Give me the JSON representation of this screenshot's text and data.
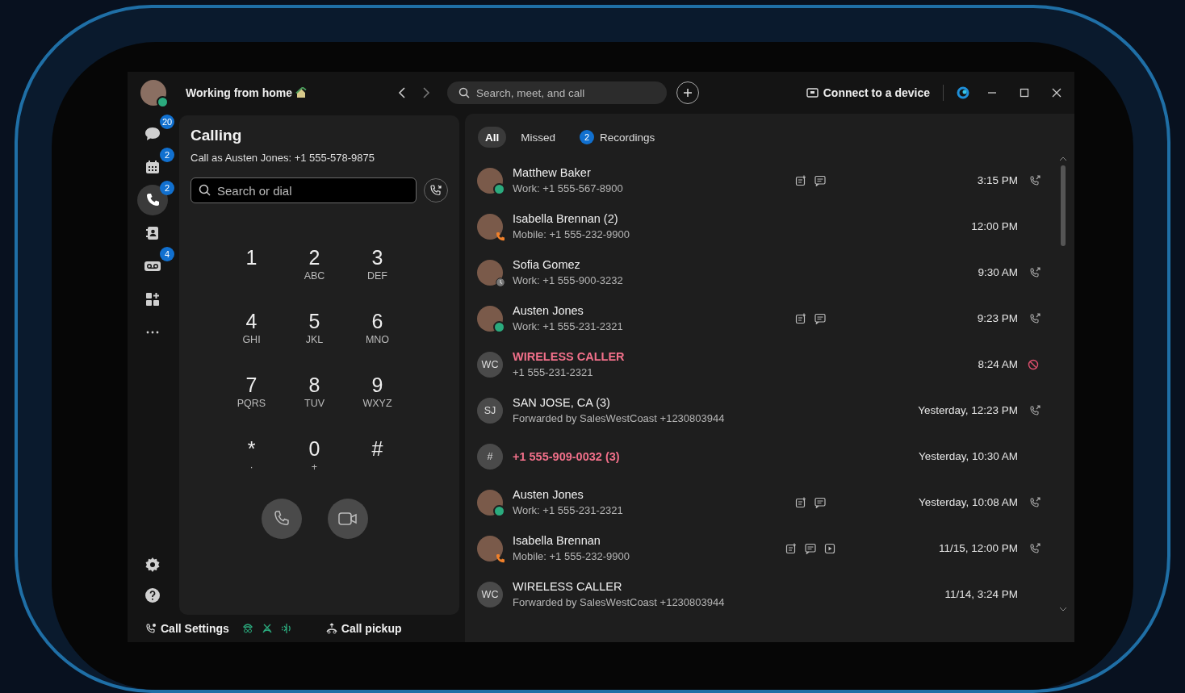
{
  "top_bar": {
    "status": "Working from home",
    "search": {
      "placeholder": "Search, meet, and call"
    },
    "connect_button": "Connect to a device"
  },
  "sidebar": {
    "items": [
      {
        "kind": "chat",
        "badge": "20",
        "selected": false
      },
      {
        "kind": "calendar",
        "badge": "2",
        "selected": false
      },
      {
        "kind": "phone",
        "badge": "2",
        "selected": true
      },
      {
        "kind": "contacts",
        "selected": false
      },
      {
        "kind": "voicemail",
        "badge": "4",
        "selected": false
      },
      {
        "kind": "apps",
        "selected": false
      },
      {
        "kind": "more",
        "selected": false
      }
    ]
  },
  "calling": {
    "title": "Calling",
    "subtitle": "Call as Austen Jones: +1 555-578-9875",
    "dial_field": {
      "placeholder": "Search or dial"
    },
    "keypad": [
      {
        "digit": "1"
      },
      {
        "digit": "2",
        "letters": "ABC"
      },
      {
        "digit": "3",
        "letters": "DEF"
      },
      {
        "digit": "4",
        "letters": "GHI"
      },
      {
        "digit": "5",
        "letters": "JKL"
      },
      {
        "digit": "6",
        "letters": "MNO"
      },
      {
        "digit": "7",
        "letters": "PQRS"
      },
      {
        "digit": "8",
        "letters": "TUV"
      },
      {
        "digit": "9",
        "letters": "WXYZ"
      },
      {
        "digit": "*",
        "letters": "·"
      },
      {
        "digit": "0",
        "letters": "+"
      },
      {
        "digit": "#"
      }
    ]
  },
  "footer": {
    "call_settings": "Call Settings",
    "call_pickup": "Call pickup"
  },
  "tabs": [
    {
      "label": "All",
      "selected": true
    },
    {
      "label": "Missed",
      "selected": false
    },
    {
      "label": "Recordings",
      "badge": "2",
      "selected": false
    }
  ],
  "calls": [
    {
      "kind": "photo",
      "presence": {
        "kind": "active"
      },
      "name": "Matthew Baker",
      "detail": "Work: +1 555-567-8900",
      "missed": false,
      "actions": [
        {
          "kind": "note"
        },
        {
          "kind": "chat"
        }
      ],
      "time": "3:15 PM",
      "call_icon": {
        "kind": "callback"
      }
    },
    {
      "kind": "photo",
      "presence": {
        "kind": "mobile"
      },
      "name": "Isabella Brennan (2)",
      "detail": "Mobile: +1 555-232-9900",
      "missed": false,
      "time": "12:00 PM"
    },
    {
      "kind": "photo",
      "presence": {
        "kind": "away"
      },
      "name": "Sofia Gomez",
      "detail": "Work: +1 555-900-3232",
      "missed": false,
      "time": "9:30 AM",
      "call_icon": {
        "kind": "callback"
      }
    },
    {
      "kind": "photo",
      "presence": {
        "kind": "active"
      },
      "name": "Austen Jones",
      "detail": "Work: +1 555-231-2321",
      "missed": false,
      "actions": [
        {
          "kind": "note"
        },
        {
          "kind": "chat"
        }
      ],
      "time": "9:23 PM",
      "call_icon": {
        "kind": "callback"
      }
    },
    {
      "kind": "initials",
      "initials": "WC",
      "name": "WIRELESS CALLER",
      "detail": "+1 555-231-2321",
      "missed": true,
      "time": "8:24 AM",
      "call_icon": {
        "kind": "blocked"
      }
    },
    {
      "kind": "initials",
      "initials": "SJ",
      "name": "SAN JOSE, CA (3)",
      "detail": "Forwarded by SalesWestCoast +1230803944",
      "missed": false,
      "time": "Yesterday, 12:23 PM",
      "call_icon": {
        "kind": "callback"
      }
    },
    {
      "kind": "initials",
      "initials": "#",
      "name": "+1 555-909-0032 (3)",
      "missed": true,
      "time": "Yesterday, 10:30 AM"
    },
    {
      "kind": "photo",
      "presence": {
        "kind": "active"
      },
      "name": "Austen Jones",
      "detail": "Work: +1 555-231-2321",
      "missed": false,
      "actions": [
        {
          "kind": "note"
        },
        {
          "kind": "chat"
        }
      ],
      "time": "Yesterday, 10:08 AM",
      "call_icon": {
        "kind": "callback"
      }
    },
    {
      "kind": "photo",
      "presence": {
        "kind": "mobile"
      },
      "name": "Isabella Brennan",
      "detail": "Mobile: +1 555-232-9900",
      "missed": false,
      "actions": [
        {
          "kind": "note"
        },
        {
          "kind": "chat"
        },
        {
          "kind": "recording"
        }
      ],
      "time": "11/15, 12:00 PM",
      "call_icon": {
        "kind": "callback"
      }
    },
    {
      "kind": "initials",
      "initials": "WC",
      "name": "WIRELESS CALLER",
      "detail": "Forwarded by SalesWestCoast +1230803944",
      "missed": false,
      "time": "11/14, 3:24 PM"
    }
  ]
}
